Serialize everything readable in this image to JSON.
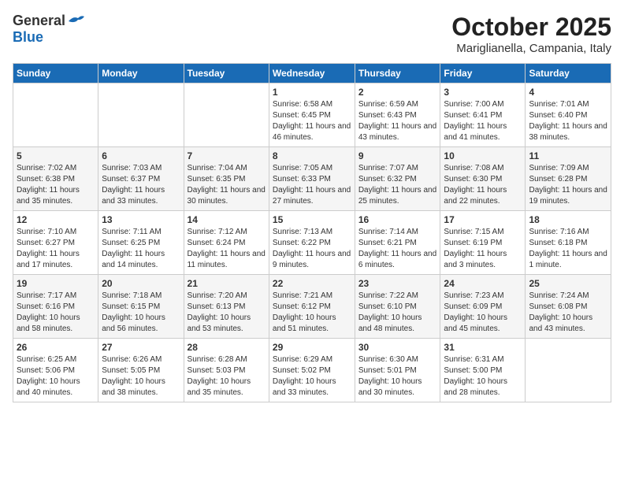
{
  "header": {
    "logo": {
      "general": "General",
      "blue": "Blue"
    },
    "title": "October 2025",
    "location": "Mariglianella, Campania, Italy"
  },
  "weekdays": [
    "Sunday",
    "Monday",
    "Tuesday",
    "Wednesday",
    "Thursday",
    "Friday",
    "Saturday"
  ],
  "weeks": [
    [
      {
        "day": "",
        "sunrise": "",
        "sunset": "",
        "daylight": ""
      },
      {
        "day": "",
        "sunrise": "",
        "sunset": "",
        "daylight": ""
      },
      {
        "day": "",
        "sunrise": "",
        "sunset": "",
        "daylight": ""
      },
      {
        "day": "1",
        "sunrise": "Sunrise: 6:58 AM",
        "sunset": "Sunset: 6:45 PM",
        "daylight": "Daylight: 11 hours and 46 minutes."
      },
      {
        "day": "2",
        "sunrise": "Sunrise: 6:59 AM",
        "sunset": "Sunset: 6:43 PM",
        "daylight": "Daylight: 11 hours and 43 minutes."
      },
      {
        "day": "3",
        "sunrise": "Sunrise: 7:00 AM",
        "sunset": "Sunset: 6:41 PM",
        "daylight": "Daylight: 11 hours and 41 minutes."
      },
      {
        "day": "4",
        "sunrise": "Sunrise: 7:01 AM",
        "sunset": "Sunset: 6:40 PM",
        "daylight": "Daylight: 11 hours and 38 minutes."
      }
    ],
    [
      {
        "day": "5",
        "sunrise": "Sunrise: 7:02 AM",
        "sunset": "Sunset: 6:38 PM",
        "daylight": "Daylight: 11 hours and 35 minutes."
      },
      {
        "day": "6",
        "sunrise": "Sunrise: 7:03 AM",
        "sunset": "Sunset: 6:37 PM",
        "daylight": "Daylight: 11 hours and 33 minutes."
      },
      {
        "day": "7",
        "sunrise": "Sunrise: 7:04 AM",
        "sunset": "Sunset: 6:35 PM",
        "daylight": "Daylight: 11 hours and 30 minutes."
      },
      {
        "day": "8",
        "sunrise": "Sunrise: 7:05 AM",
        "sunset": "Sunset: 6:33 PM",
        "daylight": "Daylight: 11 hours and 27 minutes."
      },
      {
        "day": "9",
        "sunrise": "Sunrise: 7:07 AM",
        "sunset": "Sunset: 6:32 PM",
        "daylight": "Daylight: 11 hours and 25 minutes."
      },
      {
        "day": "10",
        "sunrise": "Sunrise: 7:08 AM",
        "sunset": "Sunset: 6:30 PM",
        "daylight": "Daylight: 11 hours and 22 minutes."
      },
      {
        "day": "11",
        "sunrise": "Sunrise: 7:09 AM",
        "sunset": "Sunset: 6:28 PM",
        "daylight": "Daylight: 11 hours and 19 minutes."
      }
    ],
    [
      {
        "day": "12",
        "sunrise": "Sunrise: 7:10 AM",
        "sunset": "Sunset: 6:27 PM",
        "daylight": "Daylight: 11 hours and 17 minutes."
      },
      {
        "day": "13",
        "sunrise": "Sunrise: 7:11 AM",
        "sunset": "Sunset: 6:25 PM",
        "daylight": "Daylight: 11 hours and 14 minutes."
      },
      {
        "day": "14",
        "sunrise": "Sunrise: 7:12 AM",
        "sunset": "Sunset: 6:24 PM",
        "daylight": "Daylight: 11 hours and 11 minutes."
      },
      {
        "day": "15",
        "sunrise": "Sunrise: 7:13 AM",
        "sunset": "Sunset: 6:22 PM",
        "daylight": "Daylight: 11 hours and 9 minutes."
      },
      {
        "day": "16",
        "sunrise": "Sunrise: 7:14 AM",
        "sunset": "Sunset: 6:21 PM",
        "daylight": "Daylight: 11 hours and 6 minutes."
      },
      {
        "day": "17",
        "sunrise": "Sunrise: 7:15 AM",
        "sunset": "Sunset: 6:19 PM",
        "daylight": "Daylight: 11 hours and 3 minutes."
      },
      {
        "day": "18",
        "sunrise": "Sunrise: 7:16 AM",
        "sunset": "Sunset: 6:18 PM",
        "daylight": "Daylight: 11 hours and 1 minute."
      }
    ],
    [
      {
        "day": "19",
        "sunrise": "Sunrise: 7:17 AM",
        "sunset": "Sunset: 6:16 PM",
        "daylight": "Daylight: 10 hours and 58 minutes."
      },
      {
        "day": "20",
        "sunrise": "Sunrise: 7:18 AM",
        "sunset": "Sunset: 6:15 PM",
        "daylight": "Daylight: 10 hours and 56 minutes."
      },
      {
        "day": "21",
        "sunrise": "Sunrise: 7:20 AM",
        "sunset": "Sunset: 6:13 PM",
        "daylight": "Daylight: 10 hours and 53 minutes."
      },
      {
        "day": "22",
        "sunrise": "Sunrise: 7:21 AM",
        "sunset": "Sunset: 6:12 PM",
        "daylight": "Daylight: 10 hours and 51 minutes."
      },
      {
        "day": "23",
        "sunrise": "Sunrise: 7:22 AM",
        "sunset": "Sunset: 6:10 PM",
        "daylight": "Daylight: 10 hours and 48 minutes."
      },
      {
        "day": "24",
        "sunrise": "Sunrise: 7:23 AM",
        "sunset": "Sunset: 6:09 PM",
        "daylight": "Daylight: 10 hours and 45 minutes."
      },
      {
        "day": "25",
        "sunrise": "Sunrise: 7:24 AM",
        "sunset": "Sunset: 6:08 PM",
        "daylight": "Daylight: 10 hours and 43 minutes."
      }
    ],
    [
      {
        "day": "26",
        "sunrise": "Sunrise: 6:25 AM",
        "sunset": "Sunset: 5:06 PM",
        "daylight": "Daylight: 10 hours and 40 minutes."
      },
      {
        "day": "27",
        "sunrise": "Sunrise: 6:26 AM",
        "sunset": "Sunset: 5:05 PM",
        "daylight": "Daylight: 10 hours and 38 minutes."
      },
      {
        "day": "28",
        "sunrise": "Sunrise: 6:28 AM",
        "sunset": "Sunset: 5:03 PM",
        "daylight": "Daylight: 10 hours and 35 minutes."
      },
      {
        "day": "29",
        "sunrise": "Sunrise: 6:29 AM",
        "sunset": "Sunset: 5:02 PM",
        "daylight": "Daylight: 10 hours and 33 minutes."
      },
      {
        "day": "30",
        "sunrise": "Sunrise: 6:30 AM",
        "sunset": "Sunset: 5:01 PM",
        "daylight": "Daylight: 10 hours and 30 minutes."
      },
      {
        "day": "31",
        "sunrise": "Sunrise: 6:31 AM",
        "sunset": "Sunset: 5:00 PM",
        "daylight": "Daylight: 10 hours and 28 minutes."
      },
      {
        "day": "",
        "sunrise": "",
        "sunset": "",
        "daylight": ""
      }
    ]
  ]
}
